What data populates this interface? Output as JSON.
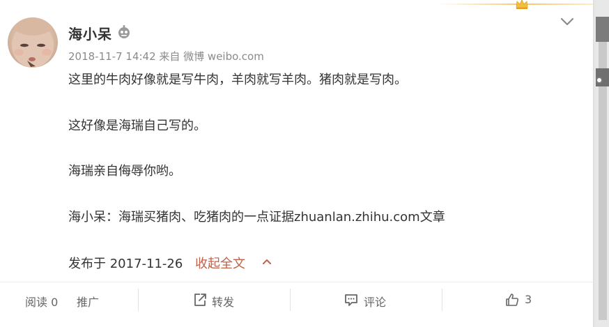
{
  "post": {
    "username": "海小呆",
    "meta": "2018-11-7 14:42 来自 微博 weibo.com",
    "paragraphs": [
      "这里的牛肉好像就是写牛肉，羊肉就写羊肉。猪肉就是写肉。",
      "这好像是海瑞自己写的。",
      "海瑞亲自侮辱你哟。",
      "海小呆：海瑞买猪肉、吃猪肉的一点证据zhuanlan.zhihu.com文章"
    ],
    "published": "发布于 2017-11-26",
    "collapse_label": "收起全文"
  },
  "footer": {
    "read_label": "阅读 0",
    "promote_label": "推广",
    "repost_label": "转发",
    "comment_label": "评论",
    "like_count": "3"
  },
  "colors": {
    "link": "#c1614a",
    "text": "#333333",
    "meta": "#8a8a8a",
    "accent_gold": "#f6c66a"
  },
  "icons": [
    "crown-icon",
    "robot-icon",
    "chevron-down-icon",
    "chevron-up-icon",
    "repost-icon",
    "comment-icon",
    "like-icon"
  ]
}
